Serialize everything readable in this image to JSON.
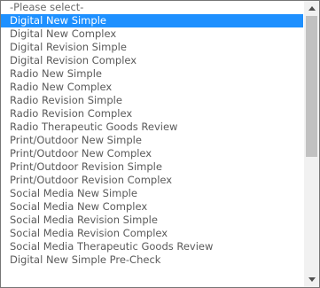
{
  "listbox": {
    "placeholder": "-Please select-",
    "selected_index": 1,
    "scroll_fraction_visible": 0.55,
    "options": [
      "-Please select-",
      "Digital New Simple",
      "Digital New Complex",
      "Digital Revision Simple",
      "Digital Revision Complex",
      "Radio New Simple",
      "Radio New Complex",
      "Radio Revision Simple",
      "Radio Revision Complex",
      "Radio Therapeutic Goods Review",
      "Print/Outdoor New Simple",
      "Print/Outdoor New Complex",
      "Print/Outdoor Revision Simple",
      "Print/Outdoor Revision Complex",
      "Social Media New Simple",
      "Social Media New Complex",
      "Social Media Revision Simple",
      "Social Media Revision Complex",
      "Social Media Therapeutic Goods Review",
      "Digital New Simple Pre-Check"
    ]
  },
  "scrollbar": {
    "up_icon": "chevron-up-icon",
    "down_icon": "chevron-down-icon"
  },
  "colors": {
    "selected_bg": "#1e90ff",
    "selected_text": "#ffffff",
    "option_text": "#5a5a5a",
    "border": "#767676",
    "track": "#f1f1f1",
    "thumb": "#c1c1c1"
  }
}
